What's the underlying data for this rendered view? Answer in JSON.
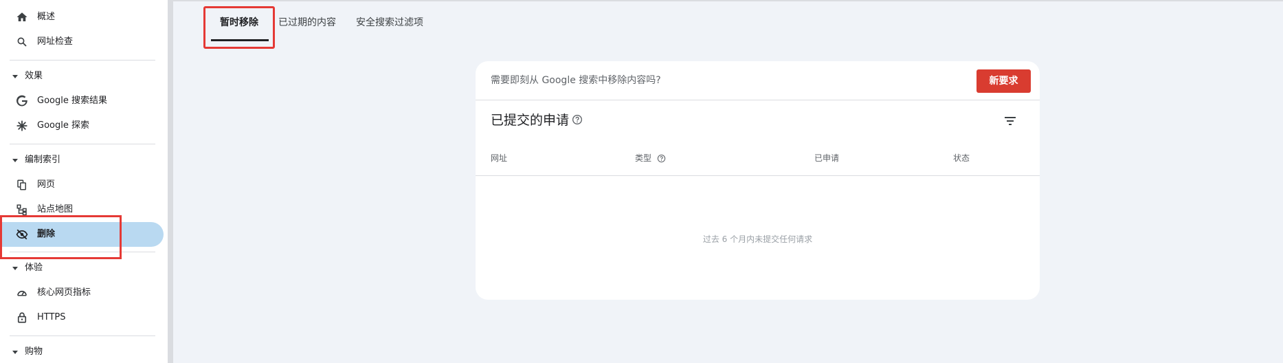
{
  "sidebar": {
    "overview": "概述",
    "url_inspection": "网址检查",
    "section_performance": "效果",
    "google_search_results": "Google 搜索结果",
    "google_discover": "Google 探索",
    "section_indexing": "编制索引",
    "pages": "网页",
    "sitemaps": "站点地图",
    "removals": "删除",
    "section_experience": "体验",
    "core_web_vitals": "核心网页指标",
    "https": "HTTPS",
    "section_shopping": "购物"
  },
  "tabs": [
    {
      "label": "暂时移除",
      "active": true
    },
    {
      "label": "已过期的内容",
      "active": false
    },
    {
      "label": "安全搜索过滤项",
      "active": false
    }
  ],
  "card": {
    "prompt": "需要即刻从 Google 搜索中移除内容吗?",
    "new_request_label": "新要求",
    "title": "已提交的申请",
    "columns": [
      "网址",
      "类型",
      "已申请",
      "状态"
    ],
    "empty_message": "过去 6 个月内未提交任何请求"
  },
  "colors": {
    "accent_button": "#d93c30",
    "active_nav_bg": "#b9d9f1",
    "highlight_box": "#e53935"
  }
}
